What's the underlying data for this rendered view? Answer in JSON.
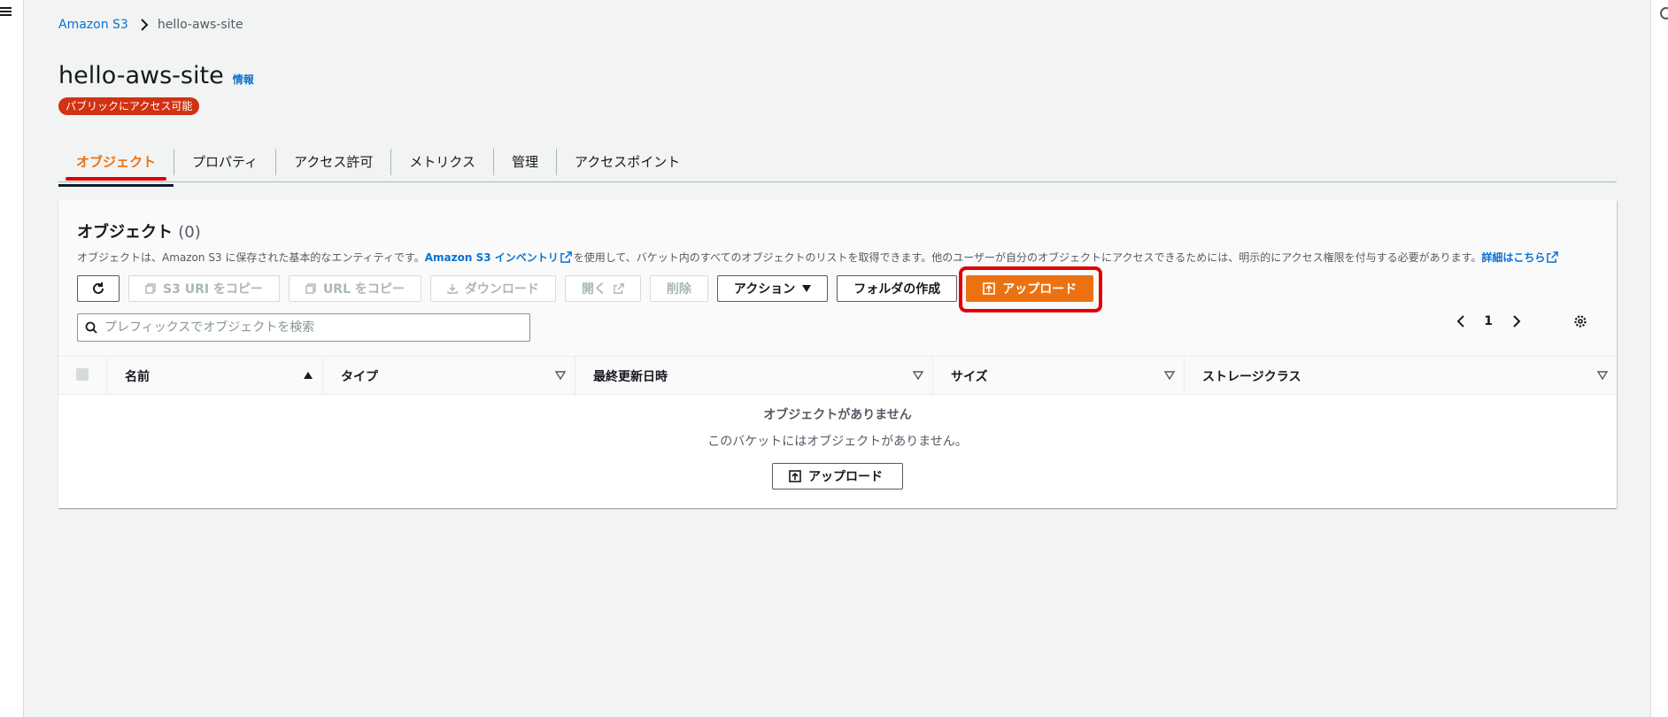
{
  "breadcrumb": {
    "root": "Amazon S3",
    "current": "hello-aws-site"
  },
  "header": {
    "title": "hello-aws-site",
    "info_link": "情報",
    "badge": "パブリックにアクセス可能"
  },
  "tabs": [
    {
      "label": "オブジェクト",
      "active": true
    },
    {
      "label": "プロパティ",
      "active": false
    },
    {
      "label": "アクセス許可",
      "active": false
    },
    {
      "label": "メトリクス",
      "active": false
    },
    {
      "label": "管理",
      "active": false
    },
    {
      "label": "アクセスポイント",
      "active": false
    }
  ],
  "objects_panel": {
    "title": "オブジェクト",
    "count": "(0)",
    "description_prefix": "オブジェクトは、Amazon S3 に保存された基本的なエンティティです。",
    "inventory_link": "Amazon S3 インベントリ",
    "description_middle": "を使用して、バケット内のすべてのオブジェクトのリストを取得できます。他のユーザーが自分のオブジェクトにアクセスできるためには、明示的にアクセス権限を付与する必要があります。",
    "details_link": "詳細はこちら",
    "toolbar": {
      "copy_s3_uri": "S3 URI をコピー",
      "copy_url": "URL をコピー",
      "download": "ダウンロード",
      "open": "開く",
      "delete": "削除",
      "actions": "アクション",
      "create_folder": "フォルダの作成",
      "upload": "アップロード"
    },
    "search": {
      "placeholder": "プレフィックスでオブジェクトを検索",
      "value": ""
    },
    "pagination": {
      "current_page": "1"
    },
    "columns": [
      "名前",
      "タイプ",
      "最終更新日時",
      "サイズ",
      "ストレージクラス"
    ],
    "empty": {
      "title": "オブジェクトがありません",
      "description": "このバケットにはオブジェクトがありません。",
      "upload_button": "アップロード"
    }
  },
  "colors": {
    "accent": "#ec7211",
    "link": "#0972d3",
    "badge": "#d13212",
    "annotation": "#e00000"
  }
}
